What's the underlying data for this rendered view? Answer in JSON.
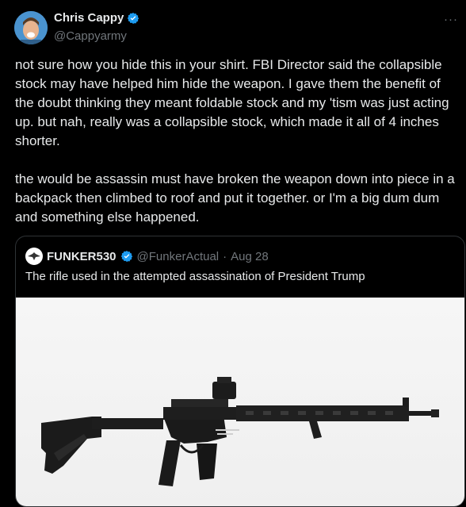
{
  "author": {
    "display_name": "Chris Cappy",
    "handle": "@Cappyarmy",
    "verified_icon": "verified-badge-icon",
    "more_label": "···"
  },
  "tweet": {
    "paragraph1": "not sure how you hide this in your shirt. FBI Director said the collapsible stock may have helped him hide the weapon. I gave them the benefit of the doubt thinking they meant foldable stock and my 'tism was just acting up. but nah, really was a collapsible stock, which made it all of 4 inches shorter.",
    "paragraph2": "the would be assassin must have broken the weapon down into piece in a backpack then climbed to roof and put it together. or I'm a big dum dum and something else happened."
  },
  "quoted": {
    "display_name": "FUNKER530",
    "handle": "@FunkerActual",
    "separator": "·",
    "date": "Aug 28",
    "text": "The rifle used in the attempted assassination of President Trump",
    "image_label": "AR-15 rifle on white background"
  },
  "colors": {
    "background": "#000000",
    "text": "#e7e9ea",
    "secondary": "#71767b",
    "verified": "#1d9bf0",
    "border": "#2f3336"
  }
}
